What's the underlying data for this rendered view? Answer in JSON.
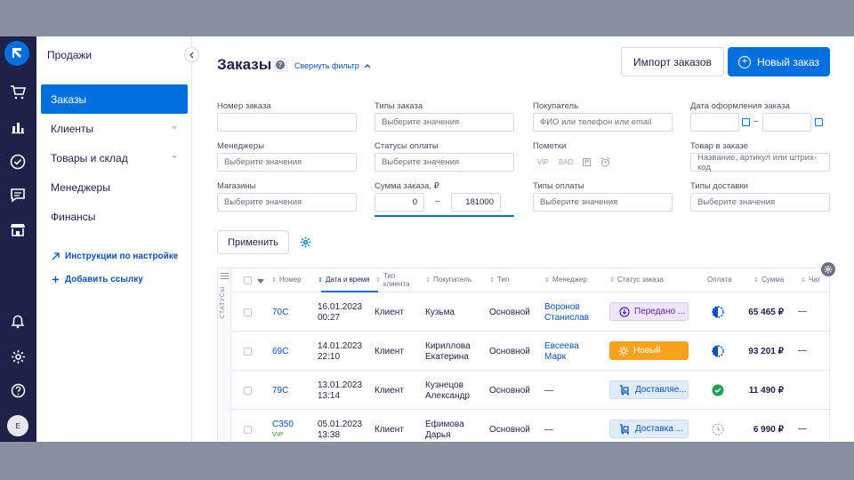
{
  "nav": {
    "section_title": "Продажи",
    "items": [
      {
        "label": "Заказы",
        "active": true
      },
      {
        "label": "Клиенты",
        "expandable": true
      },
      {
        "label": "Товары и склад",
        "expandable": true
      },
      {
        "label": "Менеджеры"
      },
      {
        "label": "Финансы"
      }
    ],
    "links": [
      {
        "label": "Инструкции по настройке",
        "icon": "arrow-up-right-icon"
      },
      {
        "label": "Добавить ссылку",
        "icon": "plus-icon"
      }
    ]
  },
  "rail": {
    "icons": [
      "logo-icon",
      "cart-icon",
      "chart-icon",
      "check-circle-icon",
      "chat-icon",
      "store-icon",
      "bell-icon",
      "gear-icon",
      "help-icon"
    ],
    "avatar": "E"
  },
  "header": {
    "title": "Заказы",
    "help": "?",
    "toggle_filter": "Свернуть фильтр",
    "import_button": "Импорт заказов",
    "new_button": "Новый заказ"
  },
  "filters": {
    "order_number": {
      "label": "Номер заказа",
      "value": ""
    },
    "order_types": {
      "label": "Типы заказа",
      "placeholder": "Выберите значения"
    },
    "buyer": {
      "label": "Покупатель",
      "placeholder": "ФИО или телефон или email"
    },
    "order_date": {
      "label": "Дата оформления заказа",
      "separator": "–"
    },
    "managers": {
      "label": "Менеджеры",
      "placeholder": "Выберите значения"
    },
    "payment_statuses": {
      "label": "Статусы оплаты",
      "placeholder": "Выберите значения"
    },
    "marks": {
      "label": "Пометки",
      "tags": [
        "VIP",
        "BAD"
      ]
    },
    "product": {
      "label": "Товар в заказе",
      "placeholder": "Название, артикул или штрих-код"
    },
    "shops": {
      "label": "Магазины",
      "placeholder": "Выберите значения"
    },
    "order_sum": {
      "label": "Сумма заказа, ₽",
      "from": "0",
      "separator": "–",
      "to": "181000"
    },
    "payment_types": {
      "label": "Типы оплаты",
      "placeholder": "Выберите значения"
    },
    "delivery_types": {
      "label": "Типы доставки",
      "placeholder": "Выберите значения"
    },
    "apply_button": "Применить"
  },
  "table": {
    "side_tab": "СТАТУСЫ",
    "columns": [
      "Номер",
      "Дата и время",
      "Тип клиента",
      "Покупатель",
      "Тип",
      "Менеджер",
      "Статус заказа",
      "Оплата",
      "Сумма",
      "Чат"
    ],
    "rows": [
      {
        "number": "70C",
        "vip": "",
        "date": "16.01.2023",
        "time": "00:27",
        "client_type": "Клиент",
        "buyer1": "Кузьма",
        "buyer2": "",
        "type": "Основной",
        "manager1": "Воронов",
        "manager2": "Станислав",
        "status": "Передано ...",
        "status_style": "purple",
        "payment": "half-circle",
        "sum": "65 465 ₽",
        "chat": "—"
      },
      {
        "number": "69C",
        "vip": "",
        "date": "14.01.2023",
        "time": "22:10",
        "client_type": "Клиент",
        "buyer1": "Кириллова",
        "buyer2": "Екатерина",
        "type": "Основной",
        "manager1": "Евсеева",
        "manager2": "Марк",
        "status": "Новый",
        "status_style": "orange",
        "payment": "half-circle",
        "sum": "93 201 ₽",
        "chat": "—"
      },
      {
        "number": "79C",
        "vip": "",
        "date": "13.01.2023",
        "time": "13:14",
        "client_type": "Клиент",
        "buyer1": "Кузнецов",
        "buyer2": "Александр",
        "type": "Основной",
        "manager1": "—",
        "manager2": "",
        "status": "Доставляе...",
        "status_style": "blue",
        "payment": "paid",
        "sum": "11 490 ₽",
        "chat": ""
      },
      {
        "number": "C350",
        "vip": "VIP",
        "date": "05.01.2023",
        "time": "13:38",
        "client_type": "Клиент",
        "buyer1": "Ефимова",
        "buyer2": "Дарья",
        "type": "Основной",
        "manager1": "—",
        "manager2": "",
        "status": "Доставка ...",
        "status_style": "blue",
        "payment": "pending",
        "sum": "6 990 ₽",
        "chat": "—"
      }
    ]
  }
}
